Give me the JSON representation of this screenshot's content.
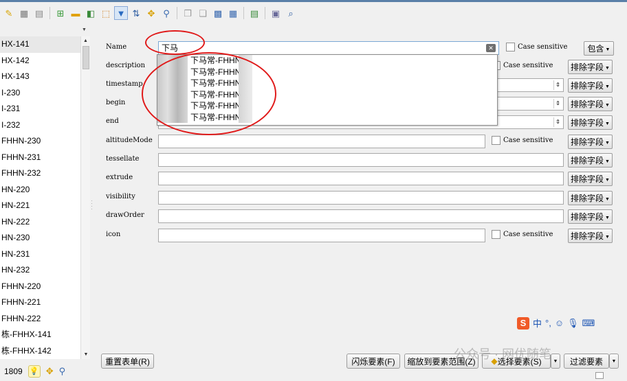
{
  "toolbar": {
    "icons": [
      "edit-icon",
      "save-edits-icon",
      "layer-icon",
      "calc-field-icon",
      "attribute-table-icon",
      "select-all-icon",
      "deselect-icon",
      "filter-icon",
      "move-selection-icon",
      "pan-to-icon",
      "zoom-to-icon",
      "copy-icon",
      "paste-icon",
      "field-calculator-icon",
      "conditional-format-icon",
      "form-view-icon",
      "table-view-icon",
      "identify-icon"
    ]
  },
  "left_list": {
    "items": [
      "HX-141",
      "HX-142",
      "HX-143",
      "I-230",
      "I-231",
      "I-232",
      "FHHN-230",
      "FHHN-231",
      "FHHN-232",
      "HN-220",
      "HN-221",
      "HN-222",
      "HN-230",
      "HN-231",
      "HN-232",
      "FHHN-220",
      "FHHN-221",
      "FHHN-222",
      "栋-FHHX-141",
      "栋-FHHX-142"
    ],
    "count": "1809"
  },
  "form": {
    "case_sensitive_label": "Case sensitive",
    "exclude_label": "排除字段",
    "contains_label": "包含",
    "fields": [
      {
        "label": "Name",
        "value": "下马"
      },
      {
        "label": "description",
        "value": ""
      },
      {
        "label": "timestamp",
        "value": ""
      },
      {
        "label": "begin",
        "value": ""
      },
      {
        "label": "end",
        "value": ""
      },
      {
        "label": "altitudeMode",
        "value": ""
      },
      {
        "label": "tessellate",
        "value": ""
      },
      {
        "label": "extrude",
        "value": ""
      },
      {
        "label": "visibility",
        "value": ""
      },
      {
        "label": "drawOrder",
        "value": ""
      },
      {
        "label": "icon",
        "value": ""
      }
    ]
  },
  "autocomplete": {
    "items": [
      "下马常-FHHN-",
      "下马常-FHHN-",
      "下马常-FHHN-.",
      "下马常-FHHN-2",
      "下马常-FHHN-2",
      "下马常-FHHN-2:"
    ]
  },
  "buttons": {
    "reset_form": "重置表单(R)",
    "flash_features": "闪烁要素(F)",
    "zoom_to_features": "缩放到要素范围(Z)",
    "select_features": "选择要素(S)",
    "filter_features": "过滤要素"
  },
  "ime": {
    "mode": "中",
    "punct": "°,"
  },
  "watermark": "公众号 · 网优随笔",
  "colors": {
    "annotation_red": "#e01a1a",
    "accent_blue": "#7aa7d4"
  }
}
